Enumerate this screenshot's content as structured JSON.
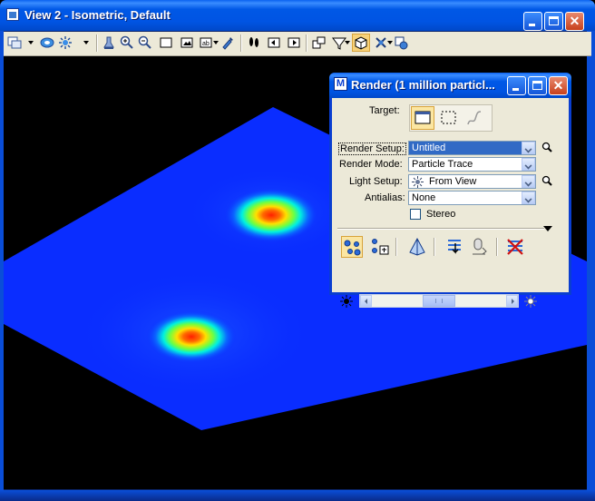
{
  "window": {
    "title": "View 2 - Isometric, Default"
  },
  "toolbar": {
    "items": [
      "view-display-icon",
      "view-attributes-icon",
      "view-rotation-icon",
      "update-view-icon",
      "zoom-in-icon",
      "zoom-out-icon",
      "window-area-icon",
      "fit-view-icon",
      "camera-icon",
      "rotate-view-icon",
      "walk-icon",
      "previous-view-icon",
      "next-view-icon",
      "copy-view-icon",
      "clip-volume-icon",
      "render-icon",
      "display-style-icon",
      "view-settings-icon"
    ]
  },
  "viewport": {
    "background": "#000000",
    "surface_color": "#0a2dff",
    "hotspots": 2
  },
  "render_dialog": {
    "title": "Render (1 million particl...",
    "target": {
      "label": "Target:",
      "options": [
        "view-target-icon",
        "fence-target-icon",
        "element-target-icon"
      ],
      "selected": 0
    },
    "render_setup": {
      "label": "Render Setup:",
      "value": "Untitled"
    },
    "render_mode": {
      "label": "Render Mode:",
      "value": "Particle Trace"
    },
    "light_setup": {
      "label": "Light Setup:",
      "value": "From View"
    },
    "antialias": {
      "label": "Antialias:",
      "value": "None"
    },
    "stereo": {
      "label": "Stereo",
      "checked": false
    },
    "tools": [
      "render-particle-trace-icon",
      "render-options-icon",
      "render-pyramid-icon",
      "save-image-icon",
      "record-icon",
      "cancel-render-icon"
    ],
    "brightness": {
      "position": 0.5
    }
  },
  "colors": {
    "titlebar": "#0054e3",
    "dialog_bg": "#ece9d8",
    "selection": "#316ac5"
  }
}
